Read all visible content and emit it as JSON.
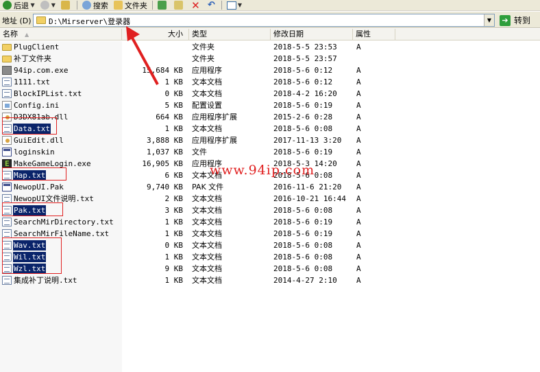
{
  "toolbar": {
    "back_label": "后退",
    "search_label": "搜索",
    "folders_label": "文件夹"
  },
  "address": {
    "label": "地址 (D)",
    "path": "D:\\Mirserver\\登录器",
    "go_label": "转到"
  },
  "columns": {
    "name": "名称",
    "size": "大小",
    "type": "类型",
    "modified": "修改日期",
    "attributes": "属性"
  },
  "files": [
    {
      "name": "PlugClient",
      "size": "",
      "type": "文件夹",
      "date": "2018-5-5 23:53",
      "attr": "A",
      "icon": "folder-icon",
      "selected": false
    },
    {
      "name": "补丁文件夹",
      "size": "",
      "type": "文件夹",
      "date": "2018-5-5 23:57",
      "attr": "",
      "icon": "folder-icon",
      "selected": false
    },
    {
      "name": "94ip.com.exe",
      "size": "15,684 KB",
      "type": "应用程序",
      "date": "2018-5-6 0:12",
      "attr": "A",
      "icon": "exe-icon",
      "selected": false
    },
    {
      "name": "1111.txt",
      "size": "1 KB",
      "type": "文本文档",
      "date": "2018-5-6 0:12",
      "attr": "A",
      "icon": "text-file-icon",
      "selected": false
    },
    {
      "name": "BlockIPList.txt",
      "size": "0 KB",
      "type": "文本文档",
      "date": "2018-4-2 16:20",
      "attr": "A",
      "icon": "text-file-icon",
      "selected": false
    },
    {
      "name": "Config.ini",
      "size": "5 KB",
      "type": "配置设置",
      "date": "2018-5-6 0:19",
      "attr": "A",
      "icon": "ini-file-icon",
      "selected": false
    },
    {
      "name": "D3DX81ab.dll",
      "size": "664 KB",
      "type": "应用程序扩展",
      "date": "2015-2-6 0:28",
      "attr": "A",
      "icon": "dll-file-icon",
      "selected": false
    },
    {
      "name": "Data.txt",
      "size": "1 KB",
      "type": "文本文档",
      "date": "2018-5-6 0:08",
      "attr": "A",
      "icon": "text-file-icon",
      "selected": true
    },
    {
      "name": "GuiEdit.dll",
      "size": "3,888 KB",
      "type": "应用程序扩展",
      "date": "2017-11-13 3:20",
      "attr": "A",
      "icon": "dll-file-icon",
      "selected": false
    },
    {
      "name": "loginskin",
      "size": "1,037 KB",
      "type": "文件",
      "date": "2018-5-6 0:19",
      "attr": "A",
      "icon": "generic-file-icon",
      "selected": false
    },
    {
      "name": "MakeGameLogin.exe",
      "size": "16,905 KB",
      "type": "应用程序",
      "date": "2018-5-3 14:20",
      "attr": "A",
      "icon": "exe-green-icon",
      "selected": false
    },
    {
      "name": "Map.txt",
      "size": "6 KB",
      "type": "文本文档",
      "date": "2018-5-6 0:08",
      "attr": "A",
      "icon": "text-file-icon",
      "selected": true
    },
    {
      "name": "NewopUI.Pak",
      "size": "9,740 KB",
      "type": "PAK 文件",
      "date": "2016-11-6 21:20",
      "attr": "A",
      "icon": "generic-file-icon",
      "selected": false
    },
    {
      "name": "NewopUI文件说明.txt",
      "size": "2 KB",
      "type": "文本文档",
      "date": "2016-10-21 16:44",
      "attr": "A",
      "icon": "text-file-icon",
      "selected": false
    },
    {
      "name": "Pak.txt",
      "size": "3 KB",
      "type": "文本文档",
      "date": "2018-5-6 0:08",
      "attr": "A",
      "icon": "text-file-icon",
      "selected": true
    },
    {
      "name": "SearchMirDirectory.txt",
      "size": "1 KB",
      "type": "文本文档",
      "date": "2018-5-6 0:19",
      "attr": "A",
      "icon": "text-file-icon",
      "selected": false
    },
    {
      "name": "SearchMirFileName.txt",
      "size": "1 KB",
      "type": "文本文档",
      "date": "2018-5-6 0:19",
      "attr": "A",
      "icon": "text-file-icon",
      "selected": false
    },
    {
      "name": "Wav.txt",
      "size": "0 KB",
      "type": "文本文档",
      "date": "2018-5-6 0:08",
      "attr": "A",
      "icon": "text-file-icon",
      "selected": true
    },
    {
      "name": "Wil.txt",
      "size": "1 KB",
      "type": "文本文档",
      "date": "2018-5-6 0:08",
      "attr": "A",
      "icon": "text-file-icon",
      "selected": true
    },
    {
      "name": "Wzl.txt",
      "size": "9 KB",
      "type": "文本文档",
      "date": "2018-5-6 0:08",
      "attr": "A",
      "icon": "text-file-icon",
      "selected": true
    },
    {
      "name": "集成补丁说明.txt",
      "size": "1 KB",
      "type": "文本文档",
      "date": "2014-4-27 2:10",
      "attr": "A",
      "icon": "text-file-icon",
      "selected": false
    }
  ],
  "watermark": "www.94ip.com",
  "colors": {
    "selection": "#0a246a",
    "annotation": "#e02020",
    "chrome": "#ece9d8"
  }
}
